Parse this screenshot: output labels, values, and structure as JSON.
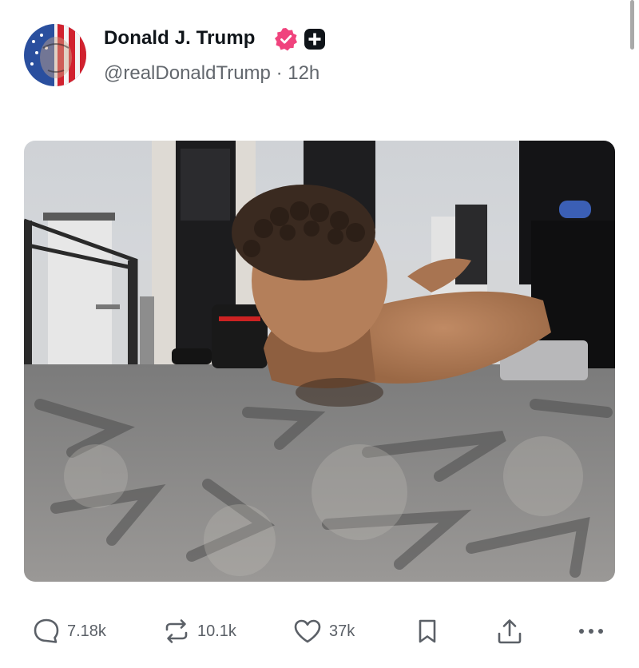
{
  "post": {
    "author_name": "Donald J. Trump",
    "handle": "@realDonaldTrump",
    "separator": "·",
    "time": "12h"
  },
  "icons": {
    "avatar": "avatar-flag-portrait",
    "verified": "verified-badge-icon",
    "plus": "plus-square-icon",
    "reply": "comment-bubble-icon",
    "repost": "repost-arrows-icon",
    "like": "heart-icon",
    "bookmark": "bookmark-icon",
    "share": "share-upload-icon",
    "more": "more-dots-icon"
  },
  "actions": {
    "replies": "7.18k",
    "reposts": "10.1k",
    "likes": "37k"
  },
  "colors": {
    "verified_badge": "#f0437d",
    "text_primary": "#0f1419",
    "text_secondary": "#62676d"
  }
}
